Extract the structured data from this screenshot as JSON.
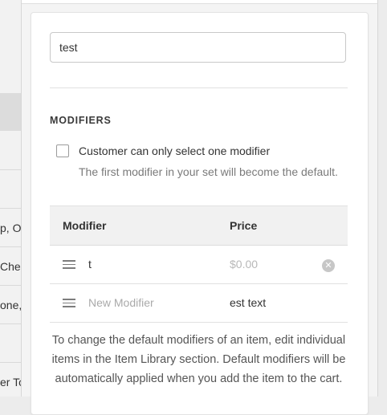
{
  "background": {
    "rows": [
      "p, Or",
      "Chee",
      "one,",
      "er To"
    ]
  },
  "item_name": {
    "value": "test"
  },
  "modifiers_section": {
    "title": "MODIFIERS",
    "single_select_label": "Customer can only select one modifier",
    "single_select_help": "The first modifier in your set will become the default.",
    "single_select_checked": false
  },
  "modifier_table": {
    "headers": {
      "modifier": "Modifier",
      "price": "Price"
    },
    "rows": [
      {
        "name": "t",
        "price_placeholder": "$0.00"
      }
    ],
    "new_row": {
      "name_placeholder": "New Modifier",
      "price_value": "est text"
    }
  },
  "footnote": "To change the default modifiers of an item, edit individual items in the Item Library section. Default modifiers will be automatically applied when you add the item to the cart."
}
